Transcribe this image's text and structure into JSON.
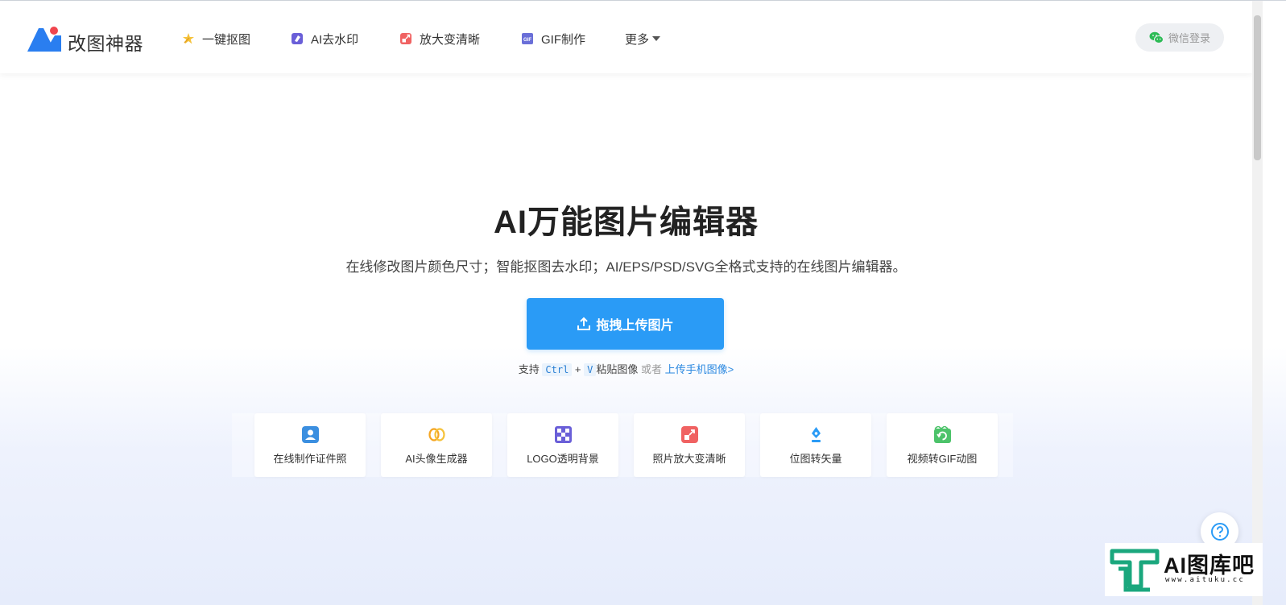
{
  "header": {
    "brand": "改图神器",
    "nav": [
      {
        "label": "一键抠图",
        "icon": "magic-wand-icon"
      },
      {
        "label": "AI去水印",
        "icon": "eraser-icon"
      },
      {
        "label": "放大变清晰",
        "icon": "enlarge-icon"
      },
      {
        "label": "GIF制作",
        "icon": "gif-icon"
      },
      {
        "label": "更多",
        "icon": "chevron-down-icon"
      }
    ],
    "login_label": "微信登录"
  },
  "hero": {
    "title": "AI万能图片编辑器",
    "subtitle": "在线修改图片颜色尺寸；智能抠图去水印；AI/EPS/PSD/SVG全格式支持的在线图片编辑器。",
    "upload_label": "拖拽上传图片",
    "paste_hint": {
      "prefix": "支持",
      "key1": "Ctrl",
      "plus": "+",
      "key2": "V",
      "paste_text": "粘贴图像",
      "or_text": "或者",
      "mobile_link": "上传手机图像>"
    }
  },
  "tools": [
    {
      "label": "在线制作证件照",
      "icon": "id-photo-icon",
      "color": "#3b8fe0"
    },
    {
      "label": "AI头像生成器",
      "icon": "avatar-swap-icon",
      "color": "#f5a623"
    },
    {
      "label": "LOGO透明背景",
      "icon": "checkerboard-icon",
      "color": "#6a5fd8"
    },
    {
      "label": "照片放大变清晰",
      "icon": "enlarge-icon",
      "color": "#f06262"
    },
    {
      "label": "位图转矢量",
      "icon": "pen-nib-icon",
      "color": "#2a9bf6"
    },
    {
      "label": "视频转GIF动图",
      "icon": "video-gif-icon",
      "color": "#4cc36a"
    }
  ],
  "watermark": {
    "title": "AI图库吧",
    "url": "www.aituku.cc"
  },
  "colors": {
    "primary": "#2a9bf6",
    "brand_red": "#f0454e",
    "link": "#2a88e0"
  }
}
